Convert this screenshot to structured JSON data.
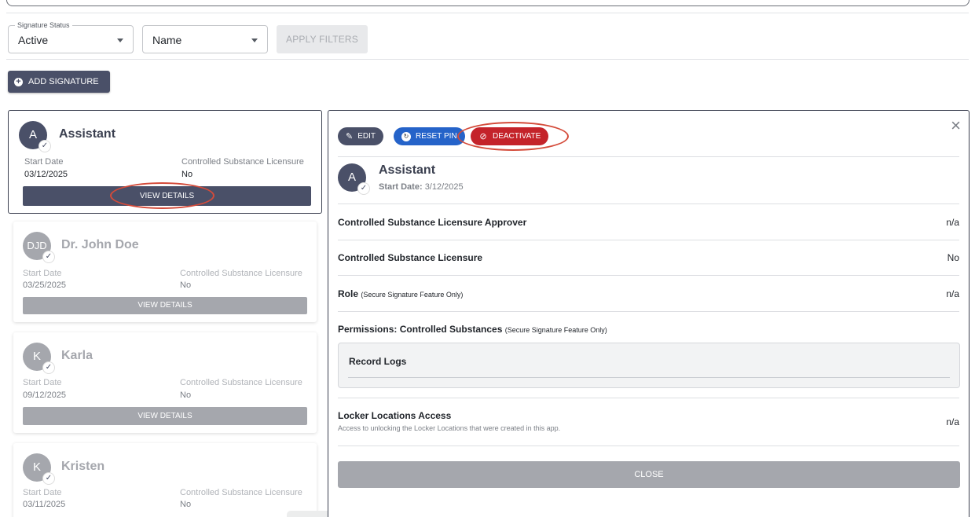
{
  "filters": {
    "status_legend": "Signature Status",
    "status_value": "Active",
    "sort_value": "Name",
    "apply_label": "APPLY FILTERS"
  },
  "add_signature_label": "ADD SIGNATURE",
  "cards": [
    {
      "initials": "A",
      "name": "Assistant",
      "start_label": "Start Date",
      "start_date": "03/12/2025",
      "cs_label": "Controlled Substance Licensure",
      "cs_value": "No",
      "view_label": "VIEW DETAILS"
    },
    {
      "initials": "DJD",
      "name": "Dr. John Doe",
      "start_label": "Start Date",
      "start_date": "03/25/2025",
      "cs_label": "Controlled Substance Licensure",
      "cs_value": "No",
      "view_label": "VIEW DETAILS"
    },
    {
      "initials": "K",
      "name": "Karla",
      "start_label": "Start Date",
      "start_date": "09/12/2025",
      "cs_label": "Controlled Substance Licensure",
      "cs_value": "No",
      "view_label": "VIEW DETAILS"
    },
    {
      "initials": "K",
      "name": "Kristen",
      "start_label": "Start Date",
      "start_date": "03/11/2025",
      "cs_label": "Controlled Substance Licensure",
      "cs_value": "No"
    }
  ],
  "detail": {
    "edit_label": "EDIT",
    "reset_pin_label": "RESET PIN",
    "deactivate_label": "DEACTIVATE",
    "close_x": "×",
    "initials": "A",
    "name": "Assistant",
    "start_date_label": "Start Date:",
    "start_date": "3/12/2025",
    "rows": {
      "approver_label": "Controlled Substance Licensure Approver",
      "approver_value": "n/a",
      "licensure_label": "Controlled Substance Licensure",
      "licensure_value": "No",
      "role_label": "Role",
      "role_note": "(Secure Signature Feature Only)",
      "role_value": "n/a",
      "permissions_label": "Permissions: Controlled Substances",
      "permissions_note": "(Secure Signature Feature Only)",
      "permission_item": "Record Logs",
      "locker_label": "Locker Locations Access",
      "locker_desc": "Access to unlocking the Locker Locations that were created in this app.",
      "locker_value": "n/a"
    },
    "close_label": "CLOSE"
  },
  "icons": {
    "badge": "signature-check-icon",
    "edit": "pencil-icon",
    "reset": "reset-pin-icon",
    "deactivate": "eye-slash-icon"
  },
  "colors": {
    "primary": "#4a5068",
    "reset_blue": "#2563c9",
    "deactivate_red": "#c4232a",
    "annotation_red": "#d44b3a"
  }
}
